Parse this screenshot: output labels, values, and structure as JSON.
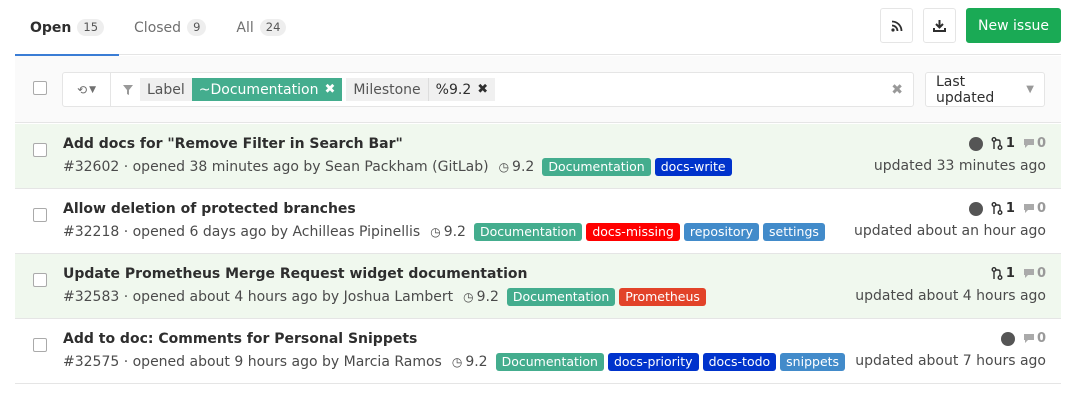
{
  "tabs": [
    {
      "label": "Open",
      "count": "15"
    },
    {
      "label": "Closed",
      "count": "9"
    },
    {
      "label": "All",
      "count": "24"
    }
  ],
  "actions": {
    "rss_icon": "rss-icon",
    "download_icon": "download-icon",
    "new_issue_label": "New issue"
  },
  "filter": {
    "label_key": "Label",
    "label_value": "~Documentation",
    "milestone_key": "Milestone",
    "milestone_value": "%9.2",
    "sort_label": "Last updated"
  },
  "colors": {
    "Documentation": "#44ad8e",
    "docs-write": "#0033cc",
    "docs-missing": "#ff0000",
    "repository": "#428bca",
    "settings": "#428bca",
    "Prometheus": "#e24329",
    "docs-priority": "#0033cc",
    "docs-todo": "#0033cc",
    "snippets": "#428bca"
  },
  "issues": [
    {
      "title": "Add docs for \"Remove Filter in Search Bar\"",
      "meta": "#32602 · opened 38 minutes ago by Sean Packham (GitLab)",
      "milestone": "9.2",
      "labels": [
        "Documentation",
        "docs-write"
      ],
      "mr_count": "1",
      "comments": "0",
      "has_avatar": true,
      "updated": "updated 33 minutes ago"
    },
    {
      "title": "Allow deletion of protected branches",
      "meta": "#32218 · opened 6 days ago by Achilleas Pipinellis",
      "milestone": "9.2",
      "labels": [
        "Documentation",
        "docs-missing",
        "repository",
        "settings"
      ],
      "mr_count": "1",
      "comments": "0",
      "has_avatar": true,
      "updated": "updated about an hour ago"
    },
    {
      "title": "Update Prometheus Merge Request widget documentation",
      "meta": "#32583 · opened about 4 hours ago by Joshua Lambert",
      "milestone": "9.2",
      "labels": [
        "Documentation",
        "Prometheus"
      ],
      "mr_count": "1",
      "comments": "0",
      "has_avatar": false,
      "updated": "updated about 4 hours ago"
    },
    {
      "title": "Add to doc: Comments for Personal Snippets",
      "meta": "#32575 · opened about 9 hours ago by Marcia Ramos",
      "milestone": "9.2",
      "labels": [
        "Documentation",
        "docs-priority",
        "docs-todo",
        "snippets"
      ],
      "mr_count": "",
      "comments": "0",
      "has_avatar": true,
      "updated": "updated about 7 hours ago"
    }
  ]
}
